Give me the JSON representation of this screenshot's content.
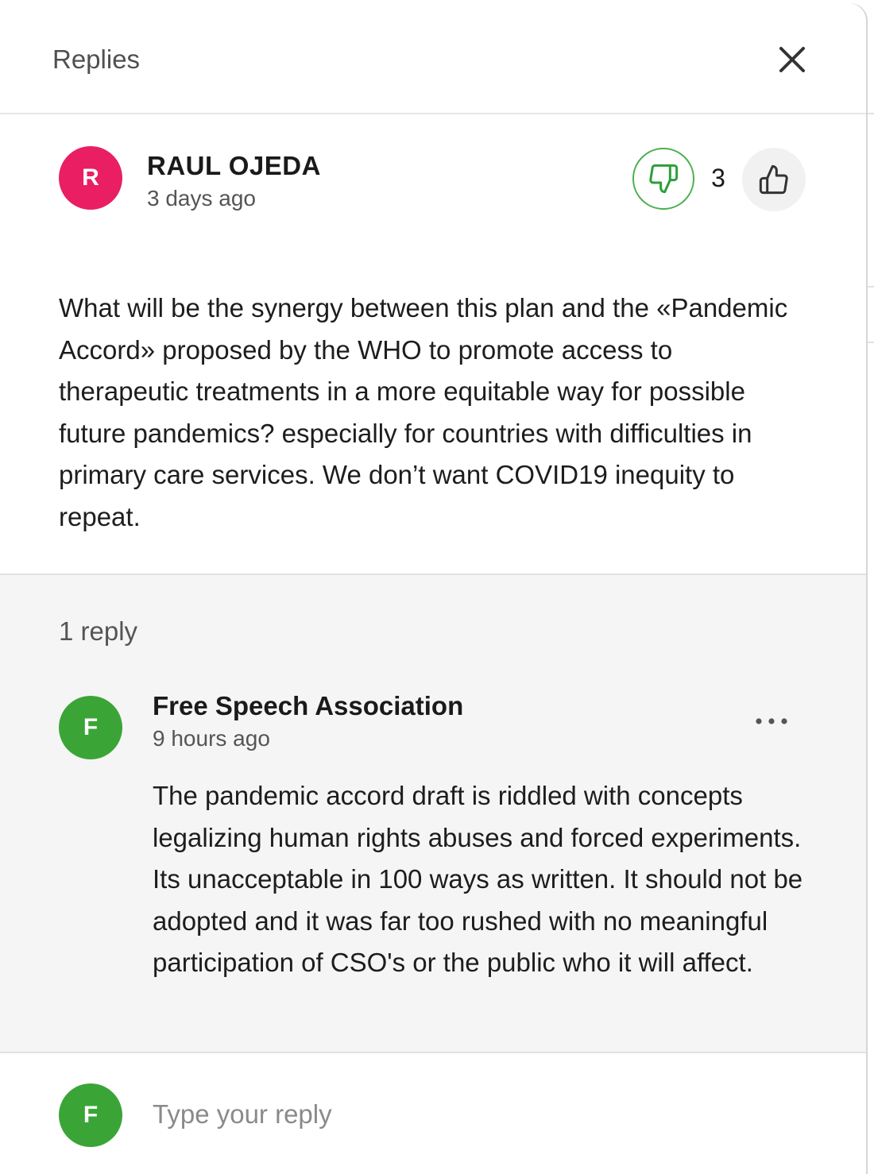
{
  "modal": {
    "title": "Replies"
  },
  "comment": {
    "avatar_letter": "R",
    "avatar_color": "#e91e63",
    "author": "RAUL OJEDA",
    "time": "3 days ago",
    "vote_count": "3",
    "body": "What will be the synergy between this plan and the «Pandemic Accord» proposed by the WHO to promote access to therapeutic treatments in a more equitable way for possible future pandemics? especially for countries with difficulties in primary care services. We don’t want COVID19 inequity to repeat."
  },
  "replies": {
    "count_label": "1 reply",
    "items": [
      {
        "avatar_letter": "F",
        "avatar_color": "#3aa536",
        "author": "Free Speech Association",
        "time": "9 hours ago",
        "body": "The pandemic accord draft is riddled with concepts legalizing human rights abuses and forced experiments. Its unacceptable in 100 ways as written. It should not be adopted and it was far too rushed with no meaningful participation of CSO's or the public who it will affect."
      }
    ]
  },
  "composer": {
    "avatar_letter": "F",
    "avatar_color": "#3aa536",
    "placeholder": "Type your reply"
  },
  "icons": {
    "close": "close-icon",
    "thumbs_down": "thumbs-down-icon",
    "thumbs_up": "thumbs-up-icon",
    "more": "more-horizontal-icon"
  },
  "colors": {
    "vote_down_accent": "#4caf50"
  }
}
